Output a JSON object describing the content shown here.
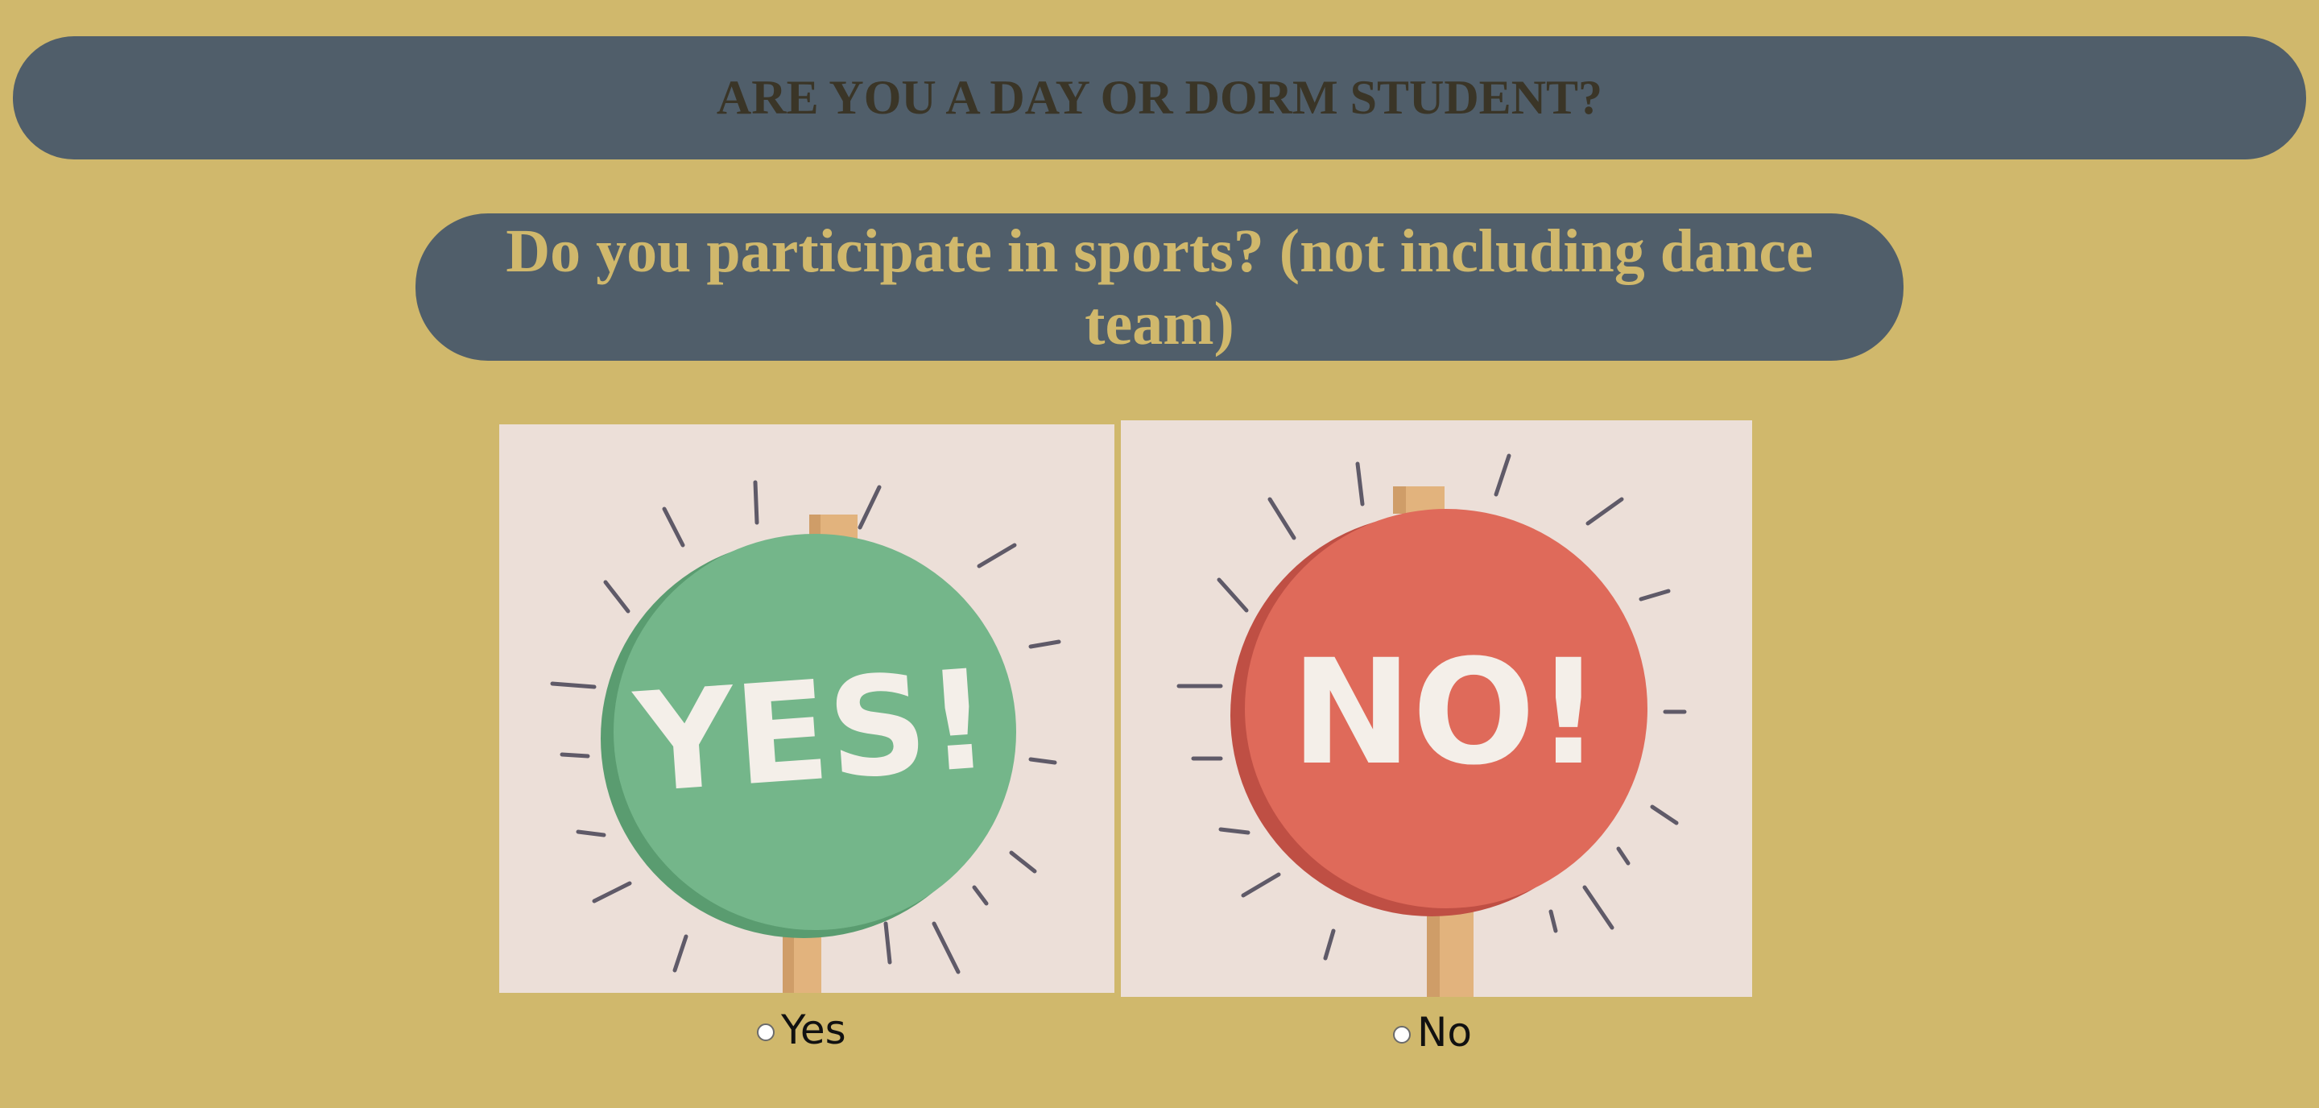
{
  "banner": {
    "title": "ARE YOU A DAY OR DORM STUDENT?"
  },
  "question": {
    "text": "Do you participate in sports? (not including dance team)"
  },
  "options": [
    {
      "sign_text": "YES!",
      "label": "Yes",
      "color": "#74b68a"
    },
    {
      "sign_text": "NO!",
      "label": "No",
      "color": "#df6a5a"
    }
  ],
  "colors": {
    "page_background": "#d0b86c",
    "panel_background": "#505e6a",
    "image_background": "#ecdfd8"
  }
}
